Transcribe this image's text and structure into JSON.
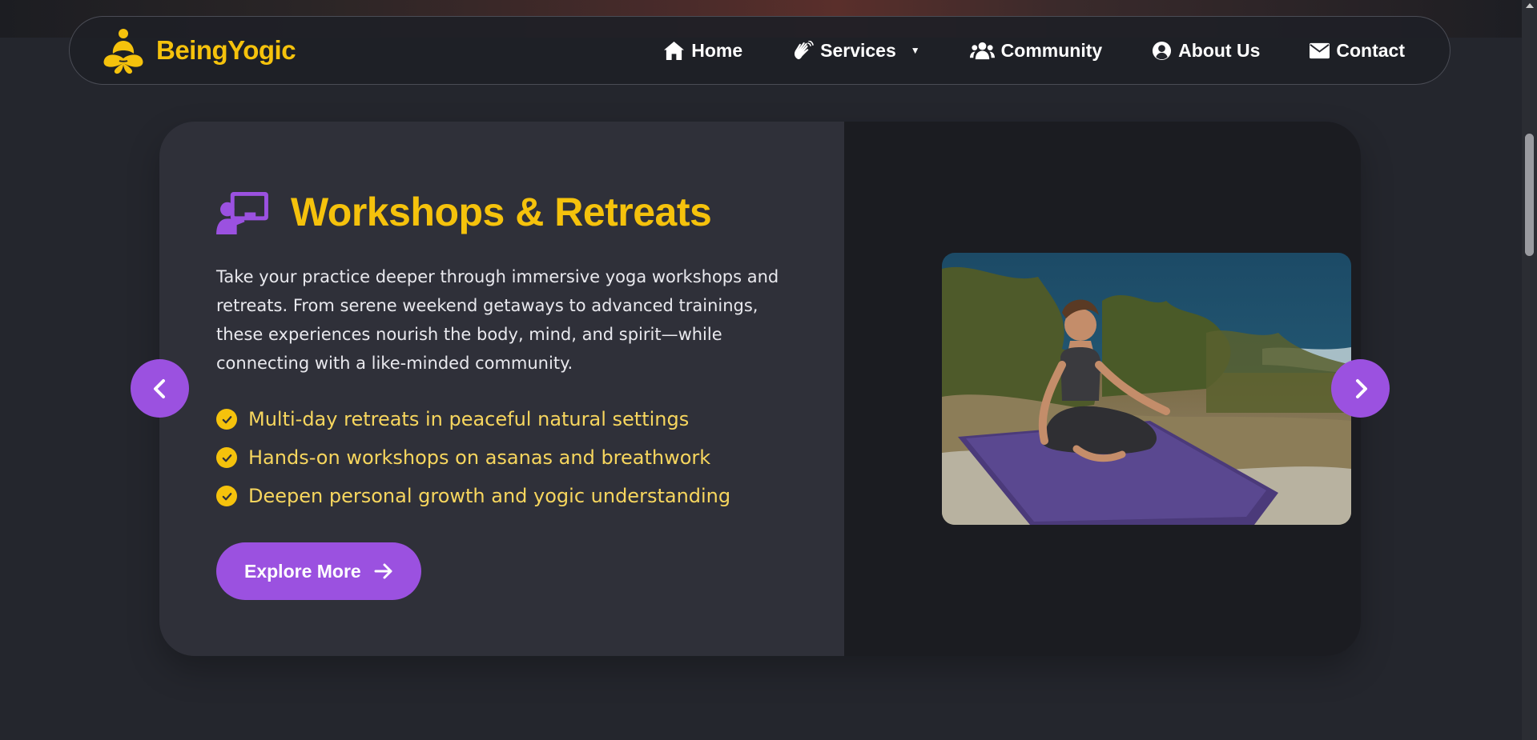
{
  "brand": {
    "name": "BeingYogic",
    "logo_icon": "meditating-person-logo"
  },
  "nav": {
    "items": [
      {
        "label": "Home",
        "icon": "home-icon"
      },
      {
        "label": "Services",
        "icon": "hands-icon",
        "caret": "▼"
      },
      {
        "label": "Community",
        "icon": "users-icon"
      },
      {
        "label": "About Us",
        "icon": "user-circle-icon"
      },
      {
        "label": "Contact",
        "icon": "envelope-icon"
      }
    ]
  },
  "slide": {
    "icon": "chalkboard-teacher-icon",
    "title": "Workshops & Retreats",
    "description": "Take your practice deeper through immersive yoga workshops and retreats. From serene weekend getaways to advanced trainings, these experiences nourish the body, mind, and spirit—while connecting with a like-minded community.",
    "features": [
      "Multi-day retreats in peaceful natural settings",
      "Hands-on workshops on asanas and breathwork",
      "Deepen personal growth and yogic understanding"
    ],
    "cta_label": "Explore More",
    "image_subject": "woman meditating on yoga mat by the sea"
  },
  "carousel": {
    "prev_icon": "chevron-left-icon",
    "next_icon": "chevron-right-icon"
  },
  "colors": {
    "accent_yellow": "#f5c20c",
    "accent_purple": "#9b51e0",
    "page_bg": "#24262d",
    "card_left_bg": "#2f3039",
    "card_right_bg": "#1b1c21"
  }
}
